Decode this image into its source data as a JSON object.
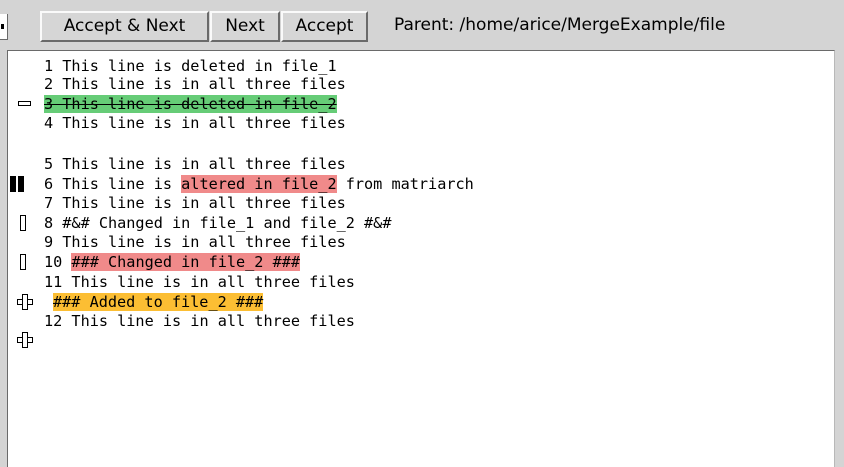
{
  "toolbar": {
    "accept_next_label": "Accept & Next",
    "next_label": "Next",
    "accept_label": "Accept",
    "parent_path": "Parent: /home/arice/MergeExample/file"
  },
  "merge_lines": {
    "l1": "1 This line is deleted in file_1",
    "l2": "2 This line is in all three files",
    "l3": "3 This line is deleted in file_2",
    "l4": "4 This line is in all three files",
    "l5": "5 This line is in all three files",
    "l6_pre": "6 This line is ",
    "l6_hl": "altered in file_2",
    "l6_post": " from matriarch",
    "l7": "7 This line is in all three files",
    "l8": "8 #&# Changed in file_1 and file_2 #&#",
    "l9": "9 This line is in all three files",
    "l10_pre": "10 ",
    "l10_hl": "### Changed in file_2 ###",
    "l11": "11 This line is in all three files",
    "l_added": "### Added to file_2 ###",
    "l12": "12 This line is in all three files"
  },
  "colors": {
    "deleted_highlight": "#66cc77",
    "changed_highlight": "#f08a8a",
    "added_highlight": "#fcbe33",
    "background": "#d4d4d4",
    "pane": "#ffffff"
  },
  "icons": {
    "deleted_marker": "minus-box-icon",
    "conflict_marker": "double-block-icon",
    "changed_marker": "thin-bar-icon",
    "added_marker": "plus-cross-icon"
  }
}
